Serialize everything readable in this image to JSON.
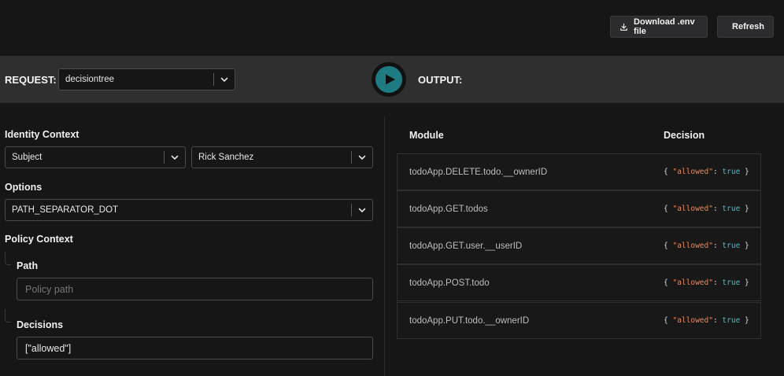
{
  "toolbar": {
    "download_label": "Download .env file",
    "refresh_label": "Refresh"
  },
  "request": {
    "label": "REQUEST:",
    "selected": "decisiontree",
    "output_label": "OUTPUT:"
  },
  "identity": {
    "title": "Identity Context",
    "type_value": "Subject",
    "user_value": "Rick Sanchez"
  },
  "options": {
    "title": "Options",
    "value": "PATH_SEPARATOR_DOT"
  },
  "policy_context": {
    "title": "Policy Context",
    "path_label": "Path",
    "path_placeholder": "Policy path",
    "decisions_label": "Decisions",
    "decisions_value": "[\"allowed\"]"
  },
  "output_table": {
    "col_module": "Module",
    "col_decision": "Decision",
    "rows": [
      {
        "module": "todoApp.DELETE.todo.__ownerID",
        "open": "{",
        "key": "\"allowed\"",
        "colon": ":",
        "value": "true",
        "close": "}"
      },
      {
        "module": "todoApp.GET.todos",
        "open": "{",
        "key": "\"allowed\"",
        "colon": ":",
        "value": "true",
        "close": "}"
      },
      {
        "module": "todoApp.GET.user.__userID",
        "open": "{",
        "key": "\"allowed\"",
        "colon": ":",
        "value": "true",
        "close": "}"
      },
      {
        "module": "todoApp.POST.todo",
        "open": "{",
        "key": "\"allowed\"",
        "colon": ":",
        "value": "true",
        "close": "}"
      },
      {
        "module": "todoApp.PUT.todo.__ownerID",
        "open": "{",
        "key": "\"allowed\"",
        "colon": ":",
        "value": "true",
        "close": "}"
      }
    ]
  },
  "colors": {
    "accent": "#1f7b82",
    "json_key": "#e58a5c",
    "json_bool": "#4fb8c9"
  },
  "icons": {
    "download": "download-icon",
    "refresh": "refresh-icon",
    "run": "play-icon",
    "dropdown": "chevron-down-icon"
  }
}
